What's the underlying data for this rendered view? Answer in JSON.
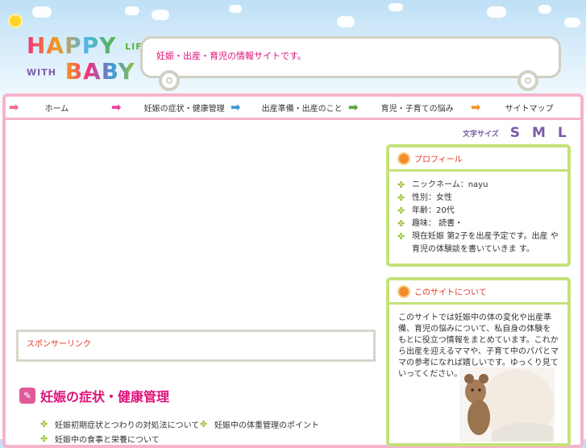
{
  "site": {
    "logo_line1": "HAPPY",
    "logo_line1_small": "LIFE",
    "logo_line2_small": "WITH",
    "logo_line2": "BABY",
    "tagline": "妊娠・出産・育児の情報サイトです。"
  },
  "nav": [
    {
      "label": "ホーム",
      "arrow_color": "#f26a8d"
    },
    {
      "label": "妊娠の症状・健康管理",
      "arrow_color": "#e8439a"
    },
    {
      "label": "出産準備・出産のこと",
      "arrow_color": "#3d9ad8"
    },
    {
      "label": "育児・子育ての悩み",
      "arrow_color": "#58a83a"
    },
    {
      "label": "サイトマップ",
      "arrow_color": "#f4922a"
    }
  ],
  "font_size": {
    "label": "文字サイズ",
    "options": [
      "S",
      "M",
      "L"
    ]
  },
  "profile": {
    "title": "プロフィール",
    "items": [
      "ニックネーム：nayu",
      "性別：女性",
      "年齢：20代",
      "趣味： 読書・",
      "現在妊娠 第2子を出産予定です。出産 や育児の体験談を書いていきま す。"
    ]
  },
  "blog": {
    "title": "このサイトについて",
    "text": "このサイトでは妊娠中の体の変化や出産準備、育児の悩みについて、私自身の体験をもとに役立つ情報をまとめています。これから出産を迎えるママや、子育て中のパパとママの参考になれば嬉しいです。ゆっくり見ていってください。よろしくお願いします。"
  },
  "ad": {
    "label": "スポンサーリンク"
  },
  "section": {
    "title": "妊娠の症状・健康管理",
    "links": [
      "妊娠初期症状とつわりの対処法について",
      "妊娠中の体重管理のポイント",
      "妊娠中の食事と栄養について"
    ]
  },
  "colors": {
    "pink_border": "#f6b4cc",
    "green_border": "#c4e27a",
    "accent_pink": "#e0117a",
    "accent_red": "#e6321e"
  }
}
